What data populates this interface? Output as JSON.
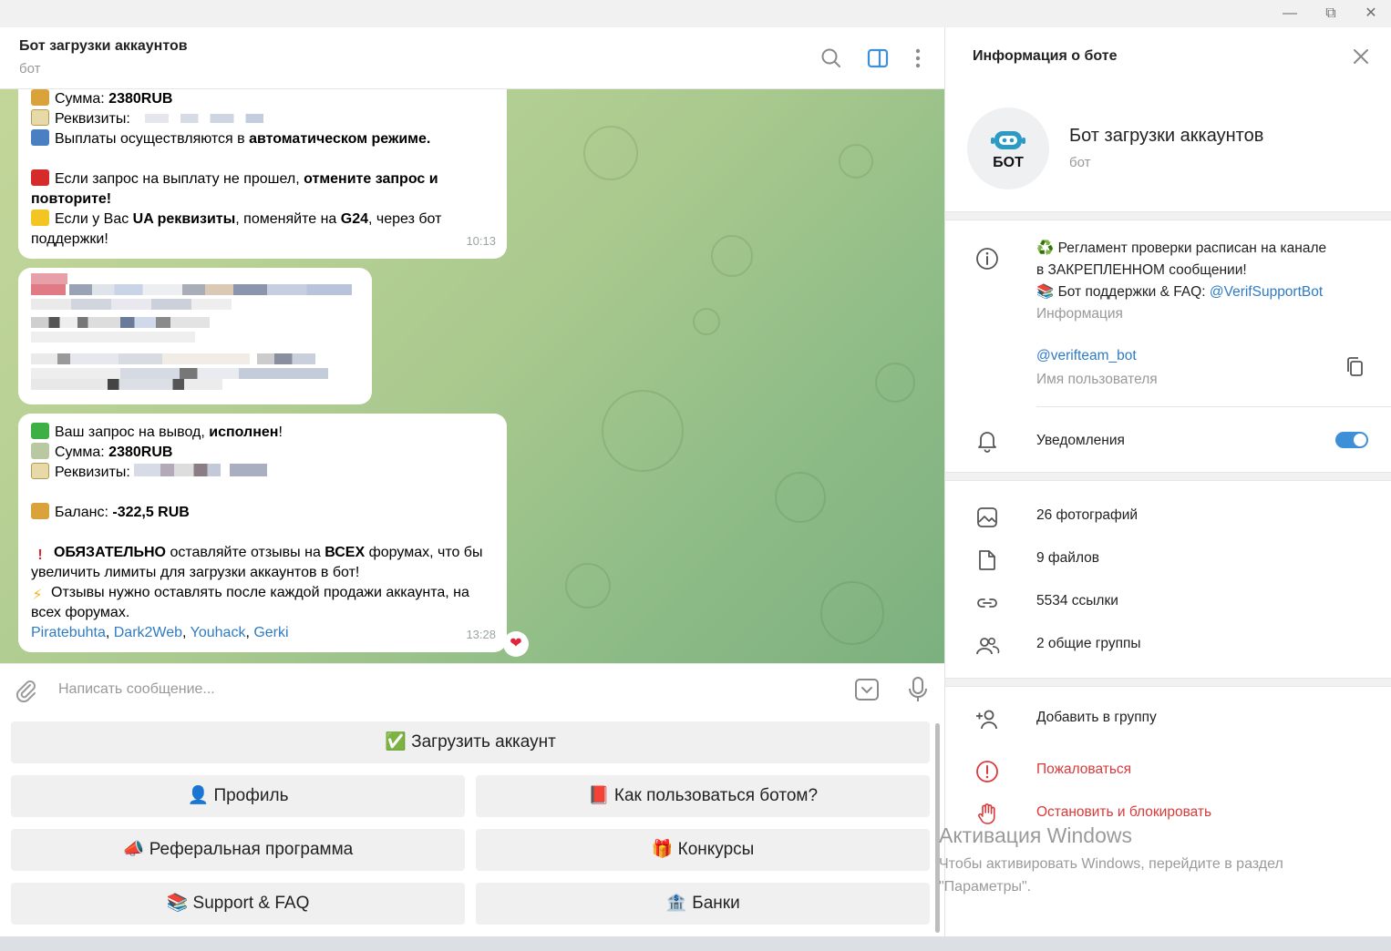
{
  "chat": {
    "title": "Бот загрузки аккаунтов",
    "subtitle": "бот"
  },
  "messages": {
    "m1": {
      "sum_label": "Сумма: ",
      "sum_value": "2380RUB",
      "requisites_label": "Реквизиты:",
      "payout_text": "Выплаты осуществляются в ",
      "payout_bold": "автоматическом режиме.",
      "fail_text": "Если запрос на выплату не прошел, ",
      "fail_bold_1": "отмените запрос и",
      "fail_bold_2": "повторите!",
      "ua_text_1": "Если у Вас ",
      "ua_bold": "UA реквизиты",
      "ua_text_2": ", поменяйте на ",
      "ua_bold_2": "G24",
      "ua_text_3": ", через бот",
      "support_text": "поддержки!",
      "time": "10:13"
    },
    "m3": {
      "done_text": "Ваш запрос на вывод, ",
      "done_bold": "исполнен",
      "done_end": "!",
      "sum_label": "Сумма: ",
      "sum_value": "2380RUB",
      "requisites_label": "Реквизиты:",
      "balance_label": "Баланс: ",
      "balance_value": "-322,5 RUB",
      "must_bold": "ОБЯЗАТЕЛЬНО",
      "must_text": " оставляйте отзывы на ",
      "must_bold_2": "ВСЕХ",
      "must_text_2": " форумах, что бы",
      "must_line2": "увеличить лимиты для загрузки аккаунтов в бот!",
      "reviews_line1": "Отзывы нужно оставлять после каждой продажи аккаунта, на",
      "reviews_line2": "всех форумах.",
      "links": [
        "Piratebuhta",
        "Dark2Web",
        "Youhack",
        "Gerki"
      ],
      "sep": ", ",
      "time": "13:28"
    }
  },
  "composer": {
    "placeholder": "Написать сообщение..."
  },
  "keyboard": {
    "upload": "✅ Загрузить аккаунт",
    "profile": "👤 Профиль",
    "howto": "📕 Как пользоваться ботом?",
    "referral": "📣 Реферальная программа",
    "contests": "🎁 Конкурсы",
    "support": "📚 Support & FAQ",
    "banks": "🏦 Банки"
  },
  "panel": {
    "title": "Информация о боте",
    "name": "Бот загрузки аккаунтов",
    "sub": "бот",
    "avatar_text": "БОТ",
    "about_line1": "♻️ Регламент проверки расписан на канале",
    "about_line2": "в ЗАКРЕПЛЕННОМ сообщении!",
    "about_line3_text": "📚 Бот поддержки & FAQ: ",
    "about_line3_link": "@VerifSupportBot",
    "about_caption": "Информация",
    "username": "@verifteam_bot",
    "username_caption": "Имя пользователя",
    "notifications": "Уведомления",
    "photos": "26 фотографий",
    "files": "9 файлов",
    "links": "5534 ссылки",
    "groups": "2 общие группы",
    "add_to_group": "Добавить в группу",
    "report": "Пожаловаться",
    "stop_block": "Остановить и блокировать"
  },
  "watermark": {
    "line1": "Активация Windows",
    "line2": "Чтобы активировать Windows, перейдите в раздел",
    "line3": "\"Параметры\"."
  },
  "colors": {
    "accent": "#3d8fd8",
    "link": "#2e7bc4",
    "danger": "#d93a3a"
  }
}
